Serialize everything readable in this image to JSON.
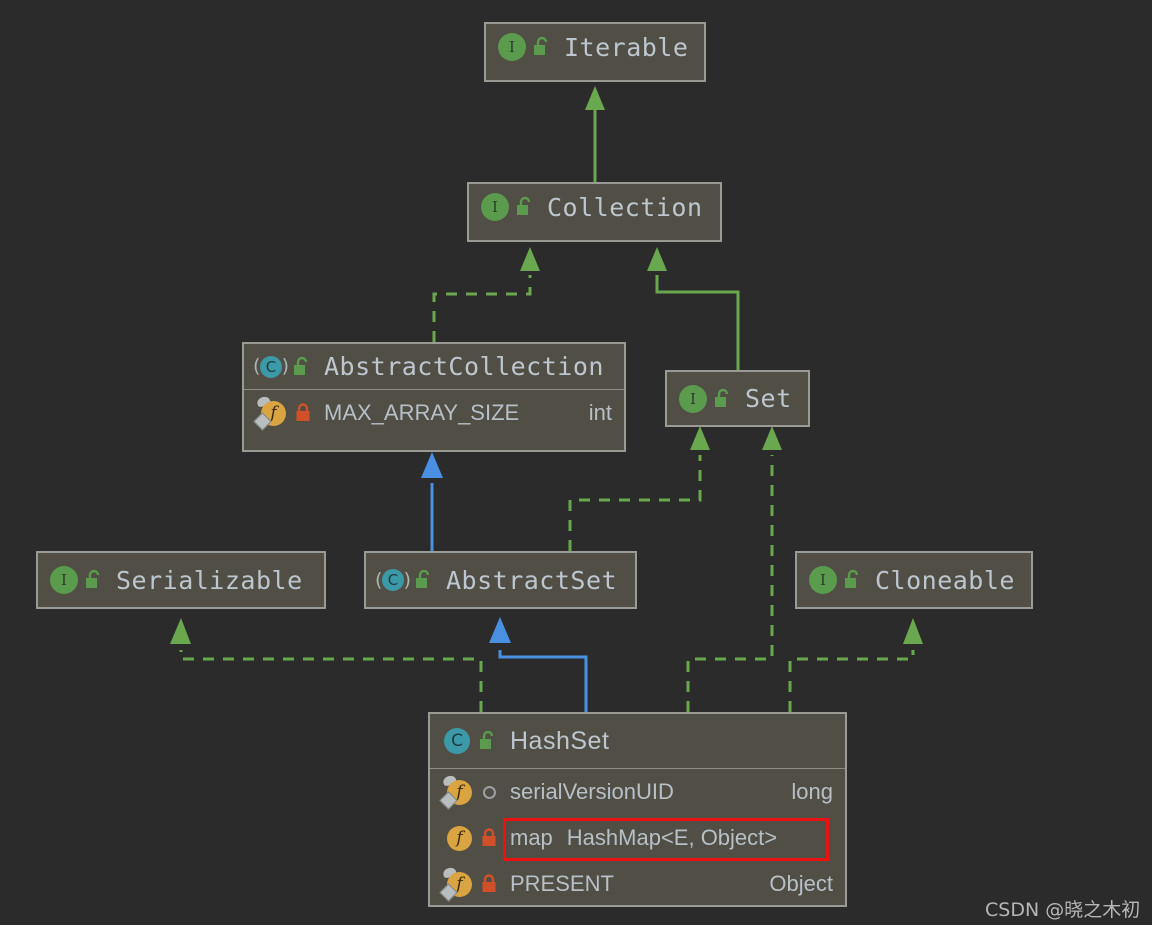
{
  "diagram": {
    "title": "Java HashSet class hierarchy",
    "background_color": "#2b2b2b",
    "node_fill": "#514f45",
    "node_border": "#9b9b96",
    "interface_arrow_color": "#6aa84f",
    "class_arrow_color": "#4a90e2",
    "highlight_color": "#ee1111"
  },
  "nodes": [
    {
      "id": "iterable",
      "name": "Iterable",
      "kind_icon": "interface-icon",
      "visibility_icon": "unlock-icon",
      "members": []
    },
    {
      "id": "collection",
      "name": "Collection",
      "kind_icon": "interface-icon",
      "visibility_icon": "unlock-icon",
      "members": []
    },
    {
      "id": "abstractcollection",
      "name": "AbstractCollection",
      "kind_icon": "class-icon",
      "visibility_icon": "unlock-icon",
      "members": [
        {
          "name": "MAX_ARRAY_SIZE",
          "type": "int",
          "field_icon": "field-static-icon",
          "visibility_icon": "lock-icon"
        }
      ]
    },
    {
      "id": "set",
      "name": "Set",
      "kind_icon": "interface-icon",
      "visibility_icon": "unlock-icon",
      "members": []
    },
    {
      "id": "serializable",
      "name": "Serializable",
      "kind_icon": "interface-icon",
      "visibility_icon": "unlock-icon",
      "members": []
    },
    {
      "id": "abstractset",
      "name": "AbstractSet",
      "kind_icon": "class-icon",
      "visibility_icon": "unlock-icon",
      "members": []
    },
    {
      "id": "cloneable",
      "name": "Cloneable",
      "kind_icon": "interface-icon",
      "visibility_icon": "unlock-icon",
      "members": []
    },
    {
      "id": "hashset",
      "name": "HashSet",
      "kind_icon": "class-icon",
      "visibility_icon": "unlock-icon",
      "members": [
        {
          "name": "serialVersionUID",
          "type": "long",
          "field_icon": "field-static-icon",
          "visibility_icon": "package-private-icon"
        },
        {
          "name": "map",
          "type": "HashMap<E, Object>",
          "field_icon": "field-icon",
          "visibility_icon": "lock-icon",
          "highlighted": true
        },
        {
          "name": "PRESENT",
          "type": "Object",
          "field_icon": "field-static-icon",
          "visibility_icon": "lock-icon"
        }
      ]
    }
  ],
  "edges": [
    {
      "from": "collection",
      "to": "iterable",
      "style": "solid-green",
      "relation": "extends-interface"
    },
    {
      "from": "abstractcollection",
      "to": "collection",
      "style": "dashed-green",
      "relation": "implements"
    },
    {
      "from": "set",
      "to": "collection",
      "style": "solid-green",
      "relation": "extends-interface"
    },
    {
      "from": "abstractset",
      "to": "abstractcollection",
      "style": "solid-blue",
      "relation": "extends-class"
    },
    {
      "from": "abstractset",
      "to": "set",
      "style": "dashed-green",
      "relation": "implements"
    },
    {
      "from": "hashset",
      "to": "abstractset",
      "style": "solid-blue",
      "relation": "extends-class"
    },
    {
      "from": "hashset",
      "to": "serializable",
      "style": "dashed-green",
      "relation": "implements"
    },
    {
      "from": "hashset",
      "to": "set",
      "style": "dashed-green",
      "relation": "implements"
    },
    {
      "from": "hashset",
      "to": "cloneable",
      "style": "dashed-green",
      "relation": "implements"
    }
  ],
  "watermark": {
    "text": "CSDN @晓之木初"
  }
}
